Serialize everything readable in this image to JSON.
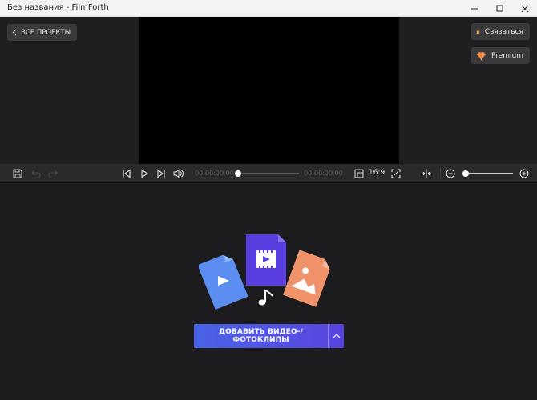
{
  "window": {
    "title": "Без названия - FilmForth"
  },
  "top": {
    "back_label": "ВСЕ ПРОЕКТЫ",
    "contact_label": "Связаться",
    "premium_label": "Premium"
  },
  "toolbar": {
    "time_current": "00:00:00.00",
    "time_total": "00:00:00.00",
    "aspect_ratio": "16:9",
    "seek_progress": 0,
    "zoom_level": 0
  },
  "main": {
    "add_button_label": "ДОБАВИТЬ ВИДЕО-/ФОТОКЛИПЫ"
  },
  "colors": {
    "accent": "#4a63e8",
    "accent_end": "#5a44e0",
    "video_card": "#5b3ee0",
    "blue_card": "#5b8ef0",
    "orange_card": "#f0936a"
  }
}
